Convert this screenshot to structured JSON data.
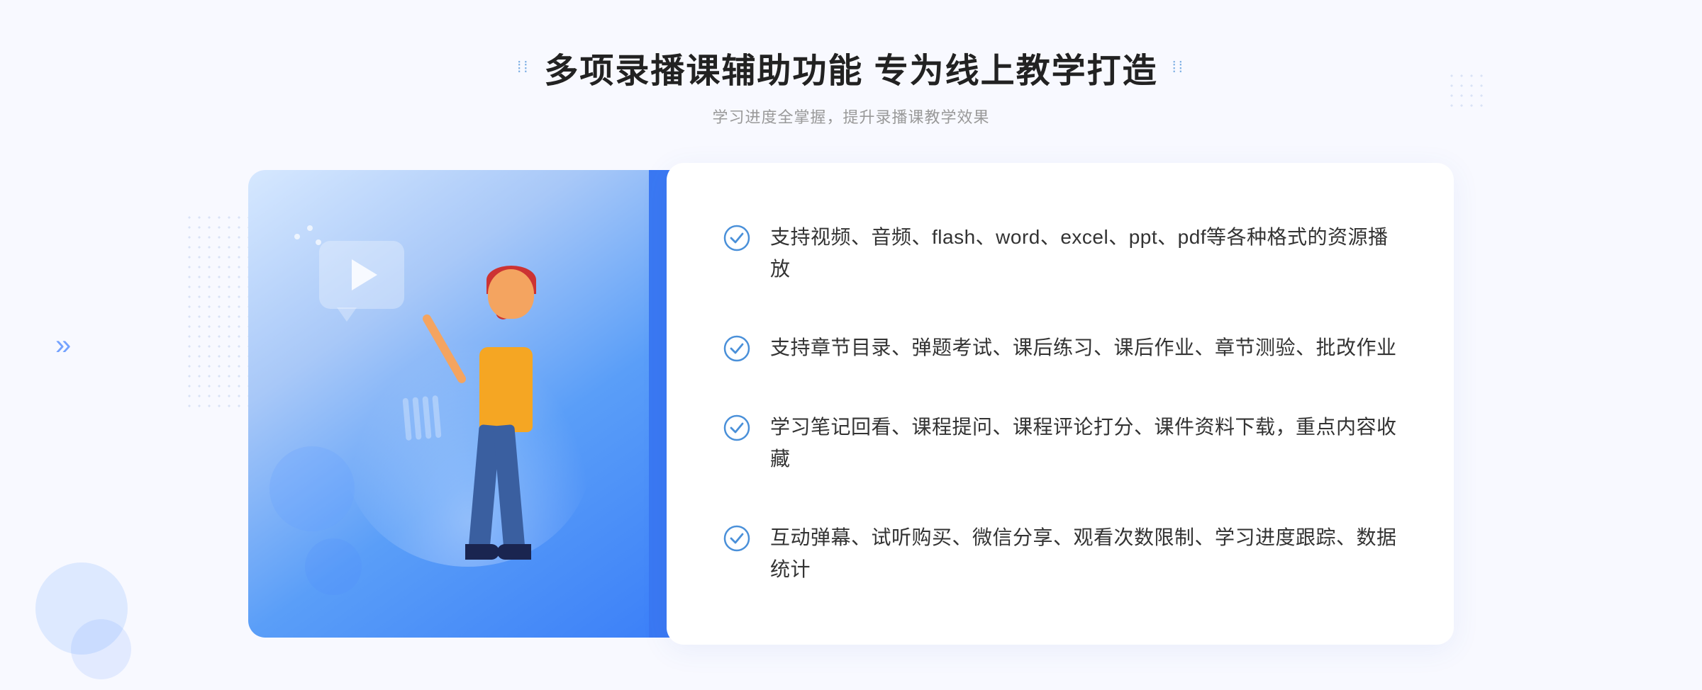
{
  "header": {
    "title": "多项录播课辅助功能 专为线上教学打造",
    "subtitle": "学习进度全掌握，提升录播课教学效果",
    "dots_left": "⁞⁞",
    "dots_right": "⁞⁞"
  },
  "features": [
    {
      "id": 1,
      "text": "支持视频、音频、flash、word、excel、ppt、pdf等各种格式的资源播放"
    },
    {
      "id": 2,
      "text": "支持章节目录、弹题考试、课后练习、课后作业、章节测验、批改作业"
    },
    {
      "id": 3,
      "text": "学习笔记回看、课程提问、课程评论打分、课件资料下载，重点内容收藏"
    },
    {
      "id": 4,
      "text": "互动弹幕、试听购买、微信分享、观看次数限制、学习进度跟踪、数据统计"
    }
  ],
  "colors": {
    "primary_blue": "#3a7ef8",
    "light_blue": "#a8c8f8",
    "check_blue": "#4a90d9",
    "text_dark": "#333333",
    "text_gray": "#999999"
  },
  "decorative": {
    "chevron": "»"
  }
}
